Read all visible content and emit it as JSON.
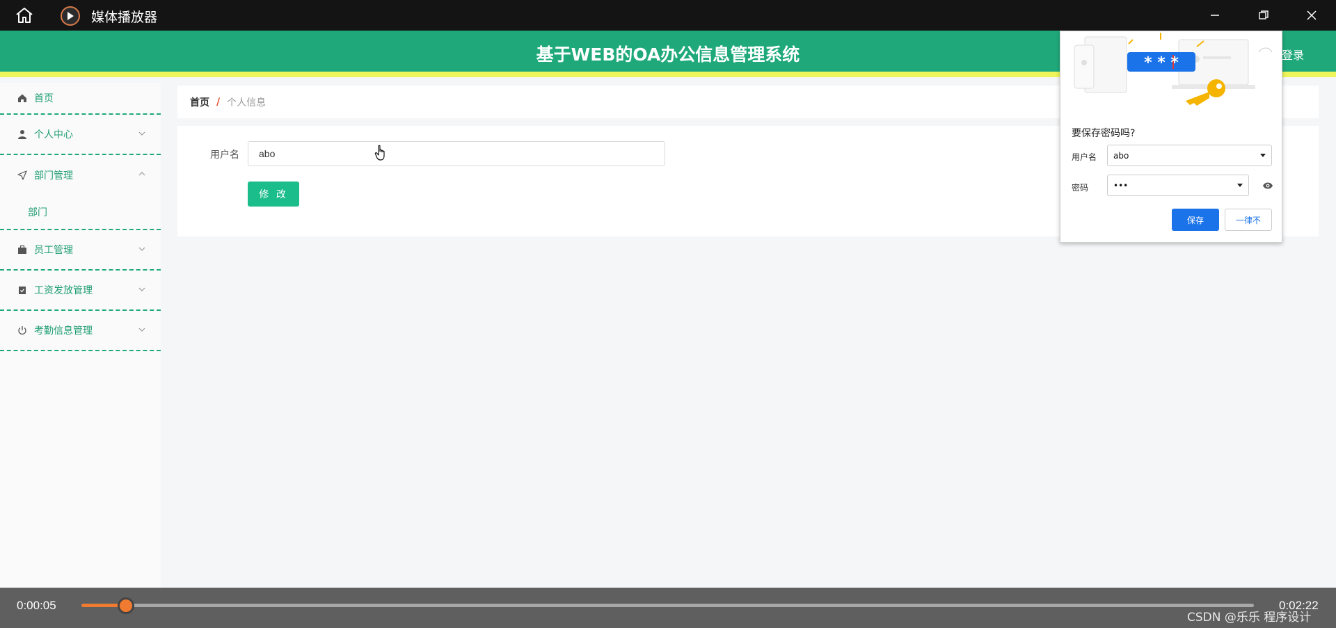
{
  "titlebar": {
    "title": "媒体播放器"
  },
  "header": {
    "title": "基于WEB的OA办公信息管理系统",
    "login": "登录"
  },
  "sidebar": {
    "items": [
      {
        "label": "首页",
        "icon": "home-icon"
      },
      {
        "label": "个人中心",
        "icon": "user-icon"
      },
      {
        "label": "部门管理",
        "icon": "navigation-icon",
        "expanded": true,
        "children": [
          "部门"
        ]
      },
      {
        "label": "员工管理",
        "icon": "briefcase-icon"
      },
      {
        "label": "工资发放管理",
        "icon": "clipboard-icon"
      },
      {
        "label": "考勤信息管理",
        "icon": "power-icon"
      }
    ]
  },
  "breadcrumb": {
    "home": "首页",
    "separator": "/",
    "current": "个人信息"
  },
  "form": {
    "username_label": "用户名",
    "username_value": "abo",
    "submit": "修 改"
  },
  "password_popup": {
    "question": "要保存密码吗?",
    "username_label": "用户名",
    "username_value": "abo",
    "password_label": "密码",
    "password_value": "•••",
    "save": "保存",
    "never": "一律不",
    "illustration_text": "* * *"
  },
  "player": {
    "current_time": "0:00:05",
    "total_time": "0:02:22",
    "progress": 0.038,
    "watermark": "CSDN @乐乐 程序设计"
  },
  "colors": {
    "accent": "#1fa97b",
    "header_stripe": "#eef55a",
    "player_orange": "#f07b30",
    "popup_blue": "#1a73e8"
  }
}
